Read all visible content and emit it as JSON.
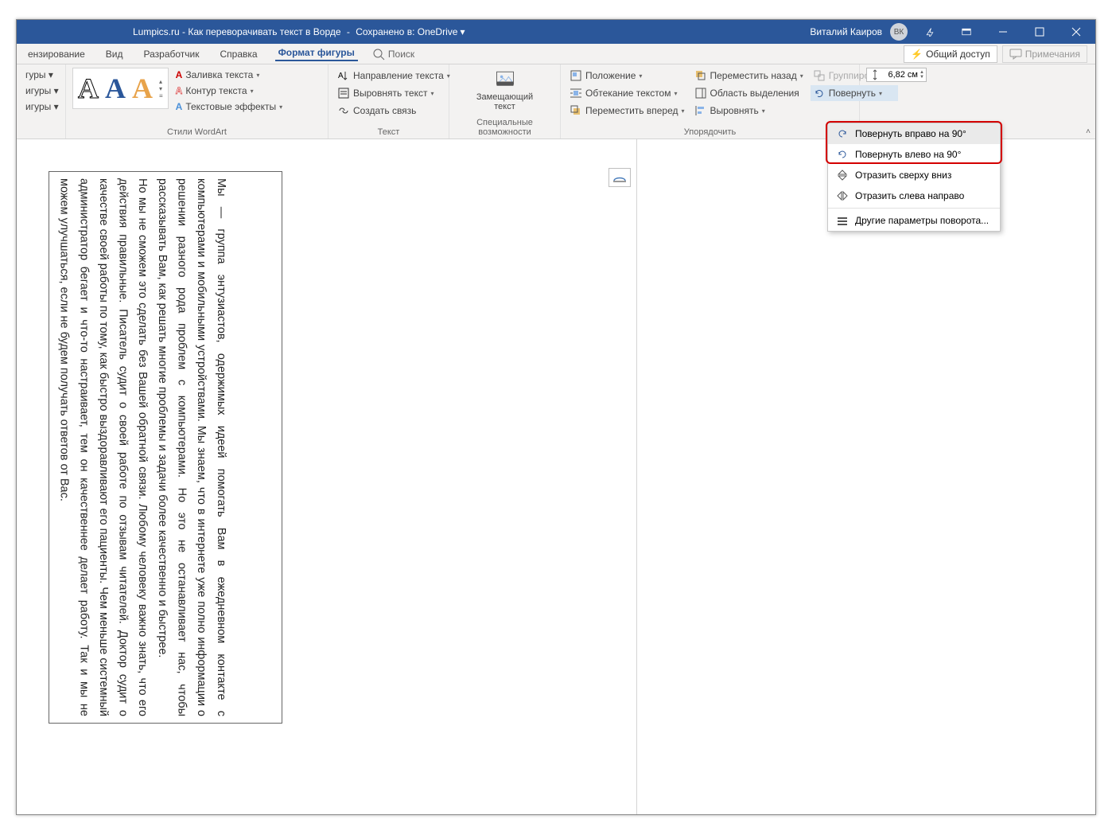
{
  "titlebar": {
    "doc_title": "Lumpics.ru - Как переворачивать текст в Ворде",
    "saved_to": "Сохранено в:",
    "onedrive": "OneDrive",
    "user_name": "Виталий Каиров",
    "user_initials": "ВК"
  },
  "tabs": {
    "items": [
      "ензирование",
      "Вид",
      "Разработчик",
      "Справка",
      "Формат фигуры"
    ],
    "search": "Поиск"
  },
  "actions": {
    "share": "Общий доступ",
    "comments": "Примечания"
  },
  "ribbon": {
    "shapes_col": {
      "a": "гуры ▾",
      "b": "игуры ▾",
      "c": "игуры ▾"
    },
    "wordart_label": "Стили WordArt",
    "text_fill": "Заливка текста",
    "text_outline": "Контур текста",
    "text_effects": "Текстовые эффекты",
    "text_direction": "Направление текста",
    "align_text": "Выровнять текст",
    "create_link": "Создать связь",
    "text_label": "Текст",
    "alt_text": "Замещающий\nтекст",
    "accessibility_label": "Специальные возможности",
    "position": "Положение",
    "wrap_text": "Обтекание текстом",
    "bring_forward": "Переместить вперед",
    "send_backward": "Переместить назад",
    "selection_pane": "Область выделения",
    "align": "Выровнять",
    "group": "Группировать",
    "rotate": "Повернуть",
    "arrange_label": "Упорядочить",
    "height_value": "6,82 см"
  },
  "dropdown": {
    "rotate_right": "Повернуть вправо на 90°",
    "rotate_left": "Повернуть влево на 90°",
    "flip_vertical": "Отразить сверху вниз",
    "flip_horizontal": "Отразить слева направо",
    "more": "Другие параметры поворота..."
  },
  "document": {
    "para1": "Мы — группа энтузиастов, одержимых идеей помогать Вам в ежедневном контакте с компьютерами и мобильными устройствами. Мы знаем, что в интернете уже полно информации о решении разного рода проблем с компьютерами. Но это не останавливает нас, чтобы рассказывать Вам, как решать многие проблемы и задачи более качественно и быстрее.",
    "para2": "Но мы не сможем это сделать без Вашей обратной связи. Любому человеку важно знать, что его действия правильные. Писатель судит о своей работе по отзывам читателей. Доктор судит о качестве своей работы по тому, как быстро выздоравливают его пациенты. Чем меньше системный администратор бегает и что-то настраивает, тем он качественнее делает работу. Так и мы не можем улучшаться, если не будем получать ответов от Вас."
  }
}
